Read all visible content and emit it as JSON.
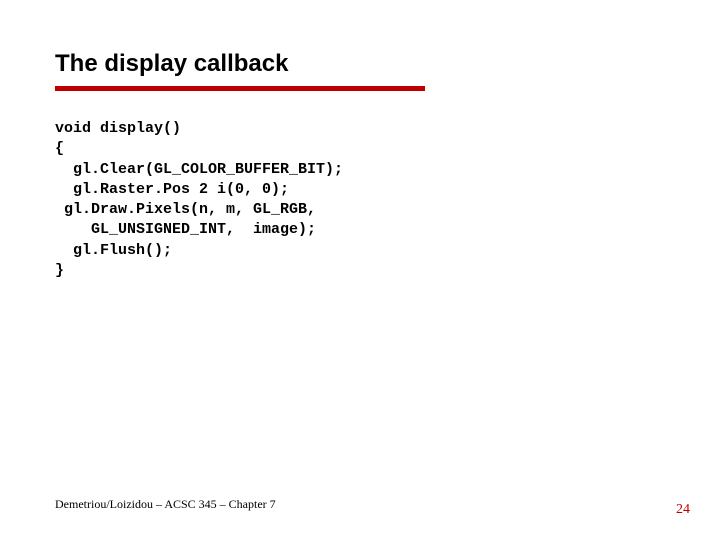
{
  "title": "The display callback",
  "code": "void display()\n{\n  gl.Clear(GL_COLOR_BUFFER_BIT);\n  gl.Raster.Pos 2 i(0, 0);\n gl.Draw.Pixels(n, m, GL_RGB,\n    GL_UNSIGNED_INT,  image);\n  gl.Flush();\n}",
  "footer": "Demetriou/Loizidou – ACSC 345 – Chapter 7",
  "page_number": "24"
}
